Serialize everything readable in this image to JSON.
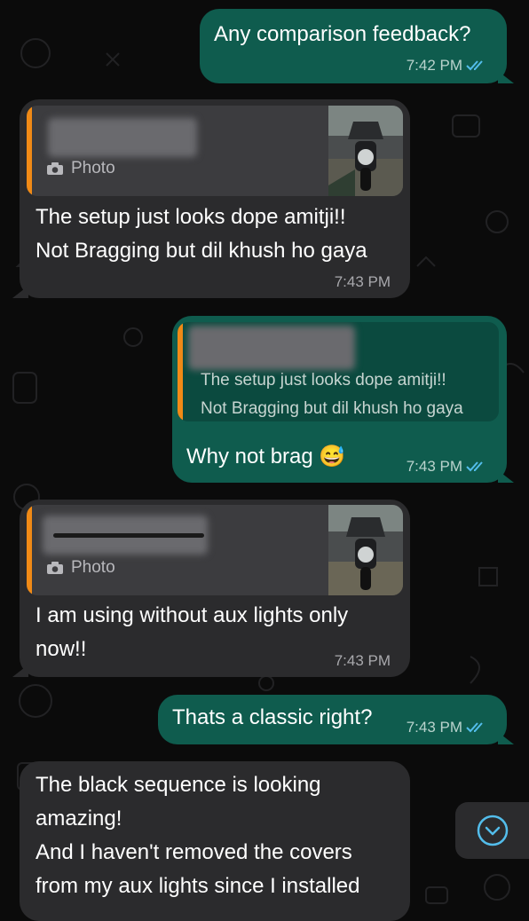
{
  "messages": [
    {
      "id": "m1",
      "direction": "outgoing",
      "text": "Any comparison feedback?",
      "time": "7:42 PM",
      "status": "read"
    },
    {
      "id": "m2",
      "direction": "incoming",
      "quote": {
        "label": "Photo",
        "has_thumbnail": true
      },
      "text": "The setup just looks dope amitji!!\nNot Bragging but dil khush ho gaya",
      "time": "7:43 PM"
    },
    {
      "id": "m3",
      "direction": "outgoing",
      "quote": {
        "text": "The setup just looks dope amitji!!\nNot Bragging but dil khush ho gaya"
      },
      "text": "Why not brag 😅",
      "time": "7:43 PM",
      "status": "read"
    },
    {
      "id": "m4",
      "direction": "incoming",
      "quote": {
        "label": "Photo",
        "has_thumbnail": true
      },
      "text": "I am using without aux lights only\nnow!!",
      "time": "7:43 PM"
    },
    {
      "id": "m5",
      "direction": "outgoing",
      "text": "Thats a classic right?",
      "time": "7:43 PM",
      "status": "read"
    },
    {
      "id": "m6",
      "direction": "incoming",
      "text": "The black sequence is looking\namazing!\nAnd I haven't removed the covers\nfrom my aux lights since I installed"
    }
  ],
  "colors": {
    "background": "#0b0b0b",
    "outgoing_bubble": "#0f5c4e",
    "incoming_bubble": "#2b2b2d",
    "quote_accent": "#f08a16",
    "read_tick": "#53bdeb"
  },
  "icons": {
    "camera": "camera-icon",
    "read_status": "double-check-icon",
    "scroll_down": "chevron-down-circle-icon"
  }
}
